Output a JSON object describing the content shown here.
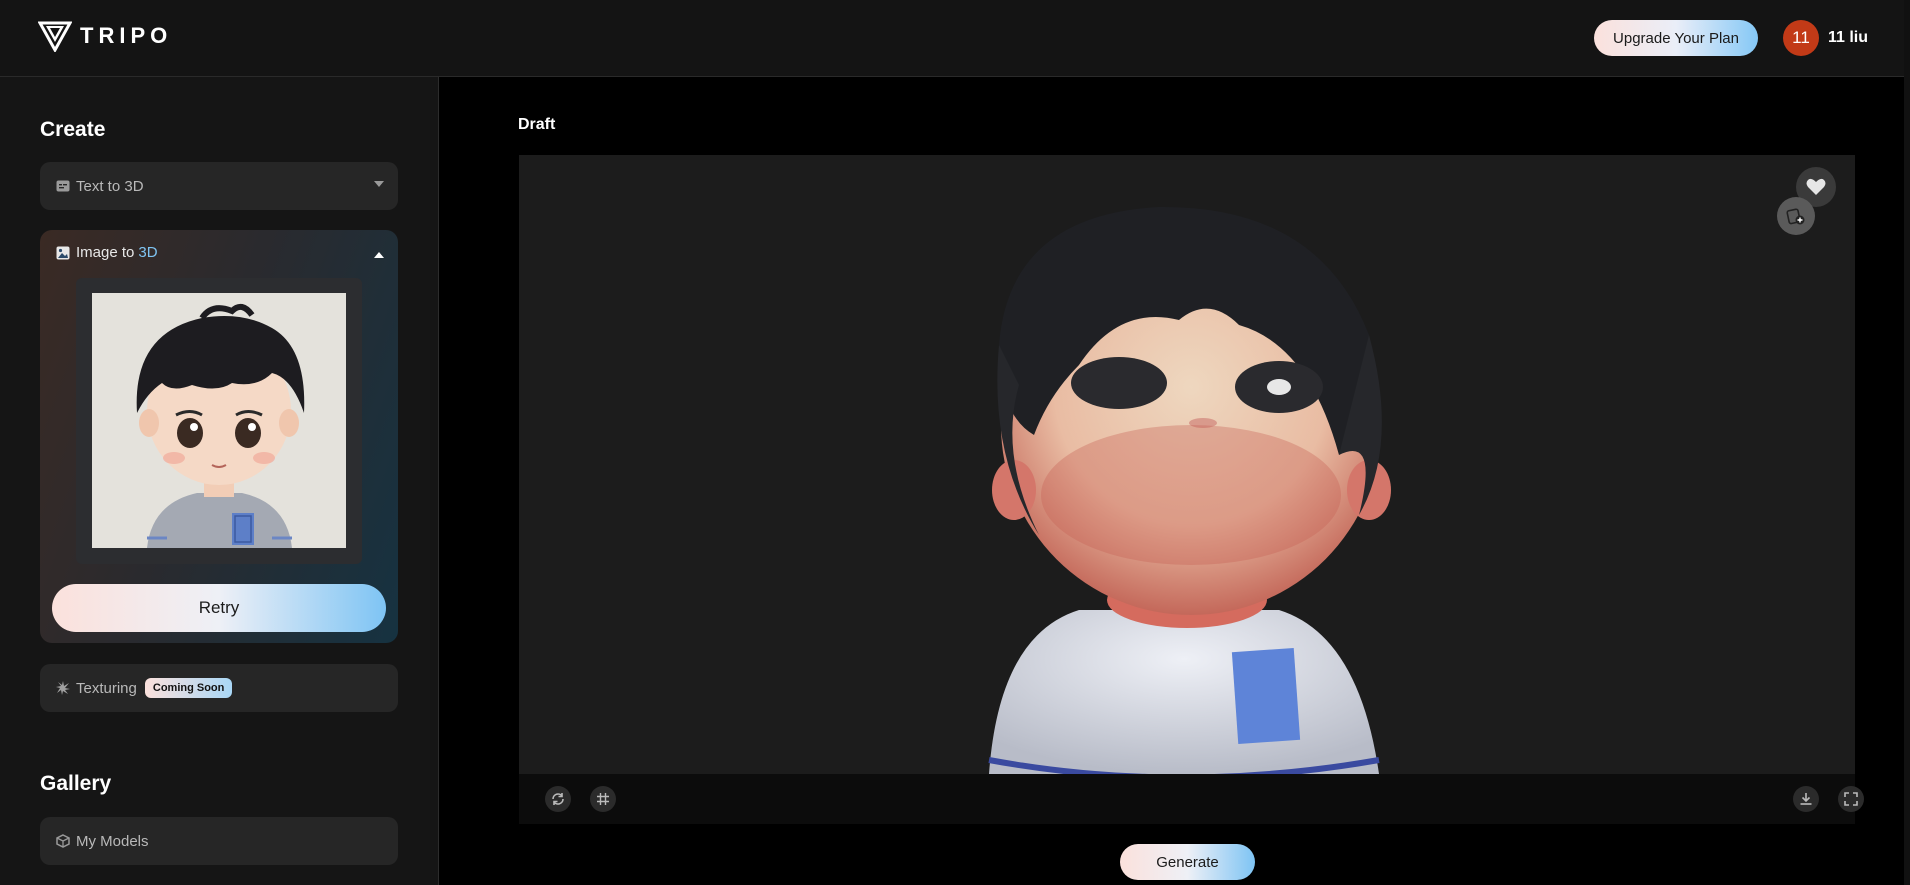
{
  "app": {
    "logo_text": "TRIPO"
  },
  "header": {
    "upgrade_label": "Upgrade Your Plan",
    "avatar_initials": "11",
    "user_name": "11 liu",
    "avatar_color": "#c23a17"
  },
  "sidebar": {
    "create_title": "Create",
    "text_to_3d_label": "Text to 3D",
    "image_to_3d": {
      "prefix": "Image to",
      "accent": "3D"
    },
    "retry_label": "Retry",
    "texturing_label": "Texturing",
    "coming_soon_label": "Coming Soon",
    "gallery_title": "Gallery",
    "my_models_label": "My Models"
  },
  "main": {
    "draft_label": "Draft",
    "generate_label": "Generate"
  },
  "icons": {
    "text_to_3d": "text-box-icon",
    "image_to_3d": "image-icon",
    "texturing": "sparkle-icon",
    "my_models": "cube-icon",
    "favorite": "heart-icon",
    "collect": "collection-add-icon",
    "rotate": "rotate-icon",
    "grid": "grid-icon",
    "download": "download-icon",
    "fullscreen": "fullscreen-icon"
  },
  "colors": {
    "accent_blue": "#7fc4f3",
    "gradient_pink": "#fbe1dc"
  }
}
